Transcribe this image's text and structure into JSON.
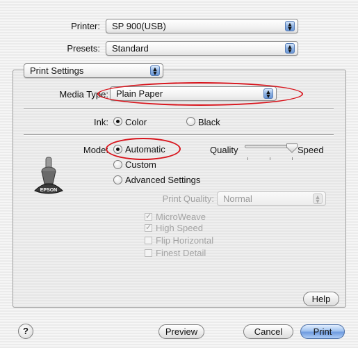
{
  "printer": {
    "label": "Printer:",
    "value": "SP 900(USB)"
  },
  "presets": {
    "label": "Presets:",
    "value": "Standard"
  },
  "section_popup": {
    "value": "Print Settings"
  },
  "media_type": {
    "label": "Media Type:",
    "value": "Plain Paper"
  },
  "ink": {
    "label": "Ink:",
    "options": [
      {
        "label": "Color",
        "selected": true
      },
      {
        "label": "Black",
        "selected": false
      }
    ]
  },
  "mode": {
    "label": "Mode:",
    "options": [
      {
        "label": "Automatic",
        "selected": true
      },
      {
        "label": "Custom",
        "selected": false
      },
      {
        "label": "Advanced Settings",
        "selected": false
      }
    ]
  },
  "quality_slider": {
    "left_label": "Quality",
    "right_label": "Speed",
    "value": 1.0
  },
  "logo": {
    "text": "EPSON"
  },
  "print_quality": {
    "label": "Print Quality:",
    "value": "Normal"
  },
  "options": [
    {
      "label": "MicroWeave",
      "checked": true
    },
    {
      "label": "High Speed",
      "checked": true
    },
    {
      "label": "Flip Horizontal",
      "checked": false
    },
    {
      "label": "Finest Detail",
      "checked": false
    }
  ],
  "buttons": {
    "help": "Help",
    "preview": "Preview",
    "cancel": "Cancel",
    "print": "Print",
    "question": "?"
  },
  "colors": {
    "annotation": "#d8141c",
    "default_button": "#6f9be0"
  }
}
